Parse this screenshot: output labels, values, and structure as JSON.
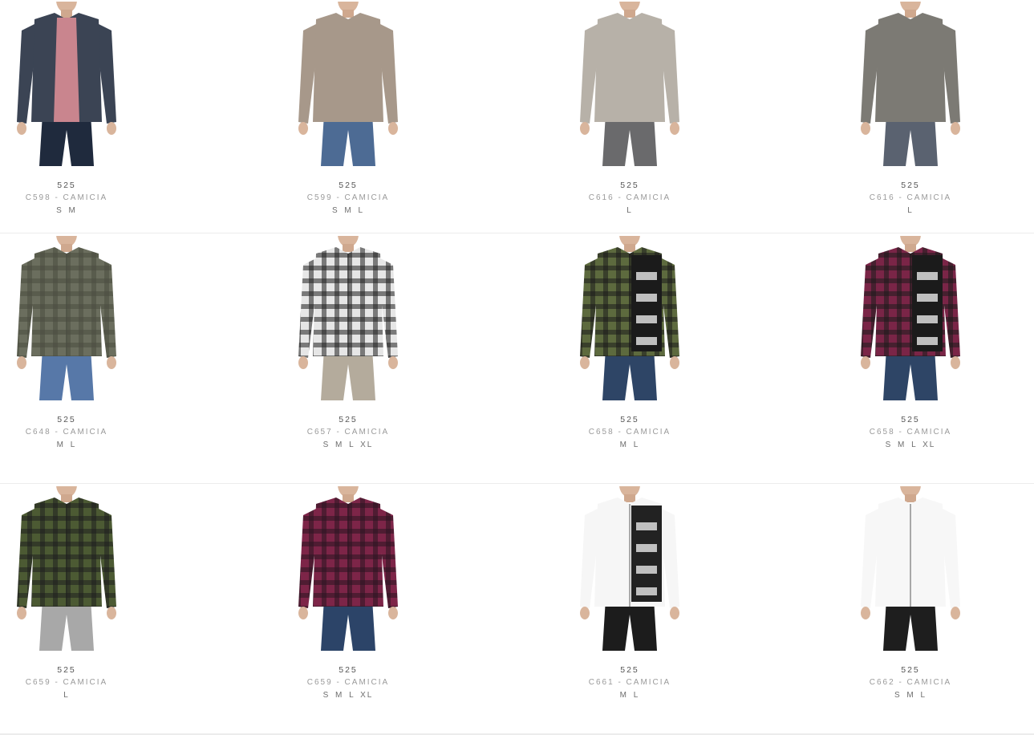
{
  "products": [
    {
      "brand": "525",
      "name": "C598 - CAMICIA",
      "sizes": "S M",
      "image": "denim-jacket-floral-shirt",
      "shirt_color": "#3b4454",
      "accent_color": "#c9858e",
      "pants_color": "#1f2a3d"
    },
    {
      "brand": "525",
      "name": "C599 - CAMICIA",
      "sizes": "S M L",
      "image": "beige-shirt",
      "shirt_color": "#a7988a",
      "accent_color": "#a7988a",
      "pants_color": "#4d6b94"
    },
    {
      "brand": "525",
      "name": "C616 - CAMICIA",
      "sizes": "L",
      "image": "light-grey-shirt",
      "shirt_color": "#b7b1a8",
      "accent_color": "#b7b1a8",
      "pants_color": "#6a6a6c"
    },
    {
      "brand": "525",
      "name": "C616 - CAMICIA",
      "sizes": "L",
      "image": "grey-shirt",
      "shirt_color": "#7c7a74",
      "accent_color": "#7c7a74",
      "pants_color": "#5a6270"
    },
    {
      "brand": "525",
      "name": "C648 - CAMICIA",
      "sizes": "M L",
      "image": "olive-check-shirt",
      "shirt_color": "#6b6e5e",
      "accent_color": "#4a4c40",
      "pants_color": "#5778a8"
    },
    {
      "brand": "525",
      "name": "C657 - CAMICIA",
      "sizes": "S M L XL",
      "image": "black-white-check-shirt",
      "shirt_color": "#e6e6e6",
      "accent_color": "#1f1f1f",
      "pants_color": "#b4ab9c"
    },
    {
      "brand": "525",
      "name": "C658 - CAMICIA",
      "sizes": "M L",
      "image": "green-check-print-shirt",
      "shirt_color": "#5d6a3e",
      "accent_color": "#1b1b1b",
      "pants_color": "#2e4566"
    },
    {
      "brand": "525",
      "name": "C658 - CAMICIA",
      "sizes": "S M L XL",
      "image": "burgundy-check-print-shirt",
      "shirt_color": "#7a2547",
      "accent_color": "#1b1b1b",
      "pants_color": "#2e4566"
    },
    {
      "brand": "525",
      "name": "C659 - CAMICIA",
      "sizes": "L",
      "image": "dark-green-check-shirt",
      "shirt_color": "#4c5a33",
      "accent_color": "#1e1e1e",
      "pants_color": "#a8a8a8"
    },
    {
      "brand": "525",
      "name": "C659 - CAMICIA",
      "sizes": "S M L XL",
      "image": "burgundy-check-shirt",
      "shirt_color": "#7d2548",
      "accent_color": "#2a1420",
      "pants_color": "#2c4468"
    },
    {
      "brand": "525",
      "name": "C661 - CAMICIA",
      "sizes": "M L",
      "image": "white-print-shirt",
      "shirt_color": "#f6f6f6",
      "accent_color": "#222222",
      "pants_color": "#1c1c1c"
    },
    {
      "brand": "525",
      "name": "C662 - CAMICIA",
      "sizes": "S M L",
      "image": "white-shirt",
      "shirt_color": "#f7f7f7",
      "accent_color": "#1c1c1c",
      "pants_color": "#1e1e1e"
    }
  ]
}
